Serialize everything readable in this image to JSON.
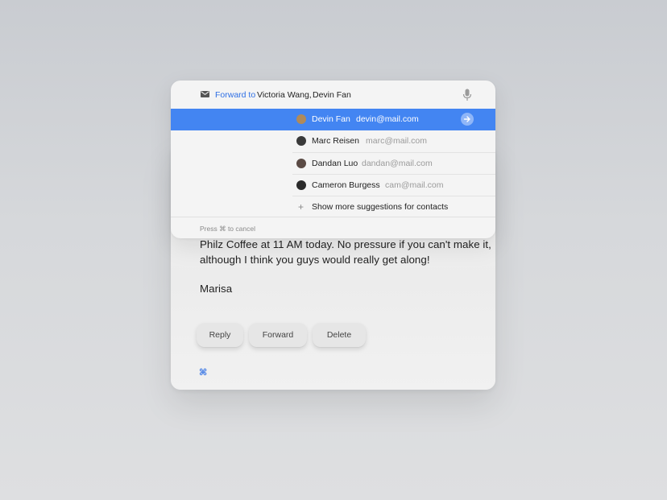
{
  "email": {
    "body_lines": [
      "Philz Coffee at 11 AM today. No pressure if you can't make it,",
      "although I think you guys would really get along!"
    ],
    "signature": "Marisa",
    "actions": [
      "Reply",
      "Forward",
      "Delete"
    ],
    "shortcut_glyph": "⌘"
  },
  "forward_panel": {
    "label": "Forward to",
    "recipients": [
      "Victoria Wang,",
      "Devin Fan"
    ],
    "suggestions": [
      {
        "name": "Devin Fan",
        "email": "devin@mail.com",
        "selected": true,
        "avatar_color": "#b08a5a"
      },
      {
        "name": "Marc Reisen",
        "email": "marc@mail.com",
        "selected": false,
        "avatar_color": "#3a3a3a"
      },
      {
        "name": "Dandan Luo",
        "email": "dandan@mail.com",
        "selected": false,
        "avatar_color": "#5a4a44"
      },
      {
        "name": "Cameron Burgess",
        "email": "cam@mail.com",
        "selected": false,
        "avatar_color": "#2a2a2a"
      }
    ],
    "more_suggestions": "Show more suggestions for contacts",
    "hint": "Press ⌘  to cancel",
    "icons": {
      "mail": "mail-icon",
      "mic": "microphone-icon",
      "go": "arrow-right-icon",
      "add": "plus-icon"
    },
    "accent_color": "#4385f2"
  }
}
